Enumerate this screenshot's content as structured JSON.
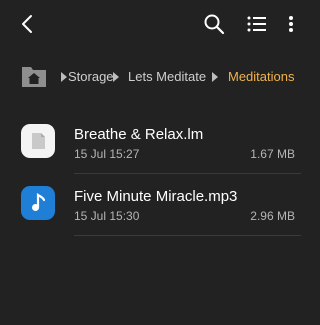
{
  "toolbar": {
    "back_icon": "back-arrow-icon",
    "search_icon": "search-icon",
    "view_icon": "list-view-icon",
    "more_icon": "more-vertical-icon"
  },
  "breadcrumb": {
    "home_icon": "home-folder-icon",
    "items": [
      "Storage",
      "Lets Meditate",
      "Meditations"
    ],
    "active_color": "#f0b34c"
  },
  "files": [
    {
      "name": "Breathe & Relax.lm",
      "date": "15 Jul 15:27",
      "size": "1.67 MB",
      "icon": "document-icon"
    },
    {
      "name": "Five Minute Miracle.mp3",
      "date": "15 Jul 15:30",
      "size": "2.96 MB",
      "icon": "music-note-icon"
    }
  ],
  "colors": {
    "background": "#222222",
    "audio_icon_bg": "#1f7fd6"
  }
}
